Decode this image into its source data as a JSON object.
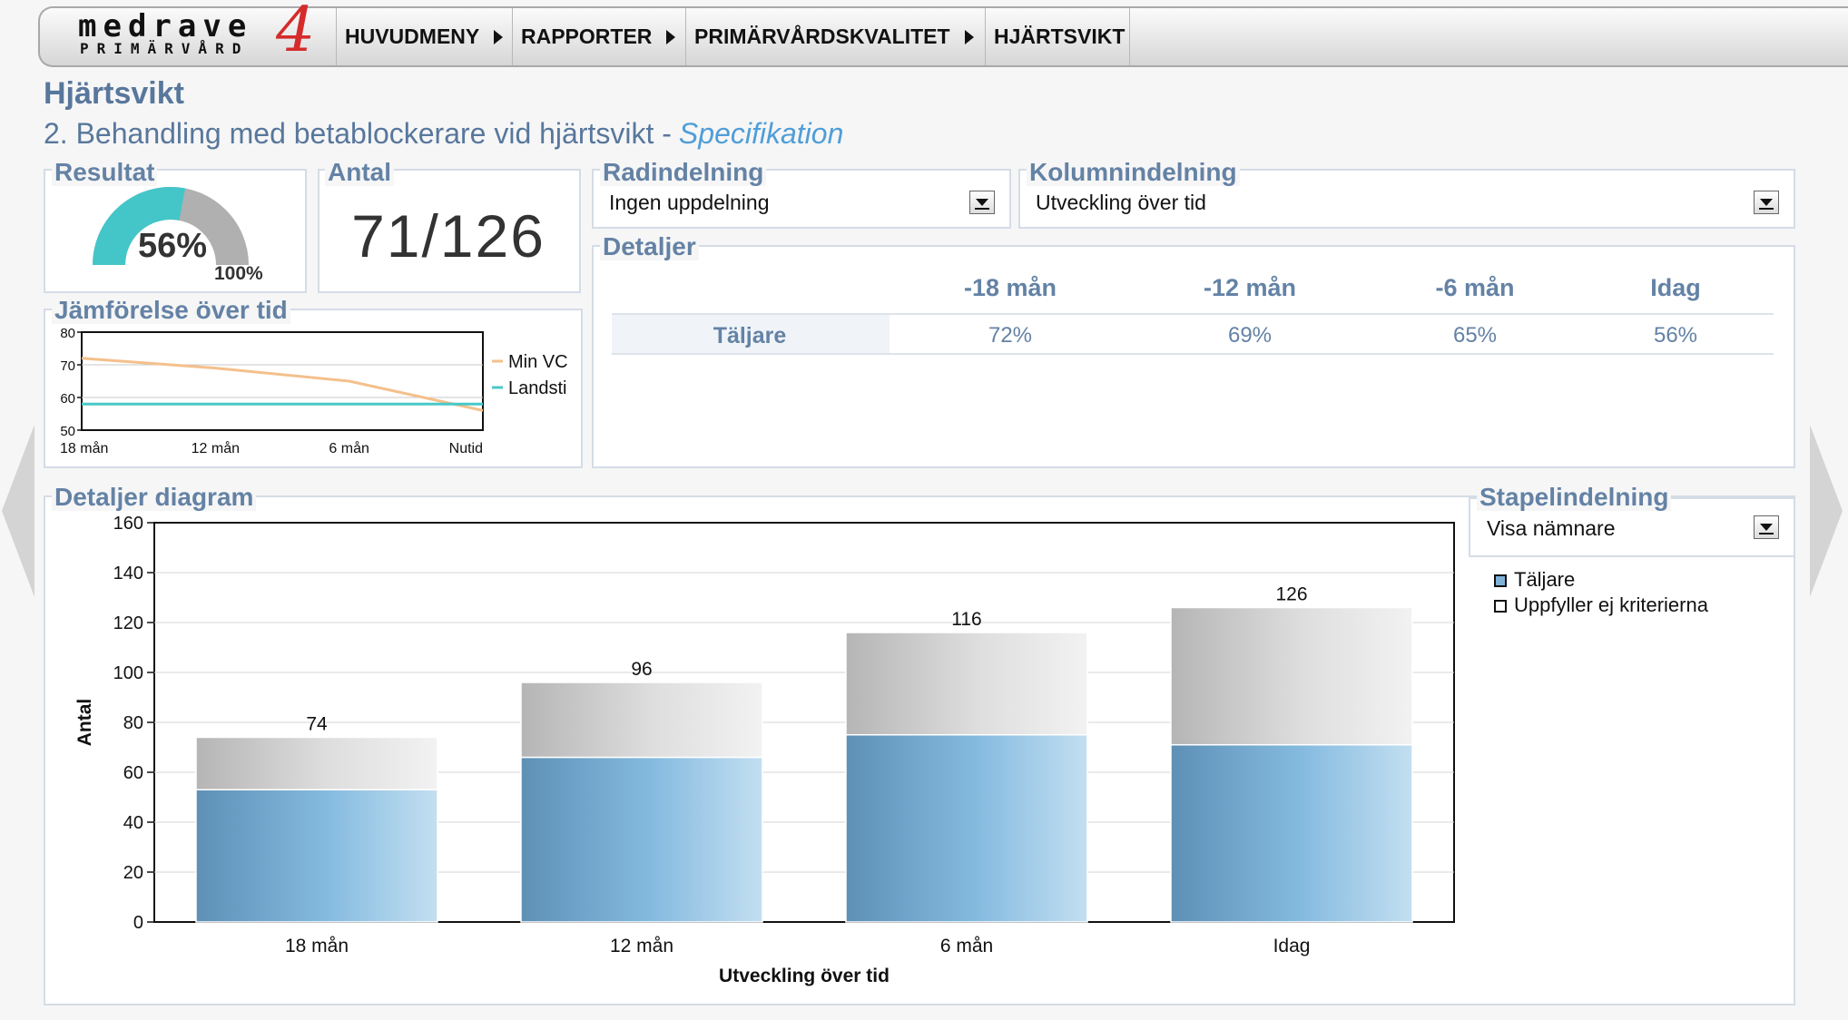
{
  "logo": {
    "word": "medrave",
    "sub": "PRIMÄRVÅRD",
    "num": "4"
  },
  "breadcrumb": [
    "HUVUDMENY",
    "RAPPORTER",
    "PRIMÄRVÅRDSKVALITET",
    "HJÄRTSVIKT"
  ],
  "page": {
    "title": "Hjärtsvikt",
    "subtitle": "2. Behandling med betablockerare vid hjärtsvikt -",
    "spec_link": "Specifikation"
  },
  "resultat": {
    "label": "Resultat",
    "value_text": "56%",
    "value": 56,
    "max_text": "100%"
  },
  "antal": {
    "label": "Antal",
    "value": "71/126"
  },
  "radindelning": {
    "label": "Radindelning",
    "selected": "Ingen uppdelning"
  },
  "kolumnindelning": {
    "label": "Kolumnindelning",
    "selected": "Utveckling över tid"
  },
  "detaljer": {
    "label": "Detaljer",
    "columns": [
      "-18 mån",
      "-12 mån",
      "-6 mån",
      "Idag"
    ],
    "rows": [
      {
        "name": "Täljare",
        "values": [
          "72%",
          "69%",
          "65%",
          "56%"
        ]
      }
    ]
  },
  "jamforelse": {
    "label": "Jämförelse över tid",
    "chart_data": {
      "type": "line",
      "x": [
        "18 mån",
        "12 mån",
        "6 mån",
        "Nutid"
      ],
      "ylim": [
        50,
        80
      ],
      "yticks": [
        50,
        60,
        70,
        80
      ],
      "series": [
        {
          "name": "Min VC",
          "values": [
            72,
            69,
            65,
            56
          ],
          "color": "#f4c08c"
        },
        {
          "name": "Landsting",
          "values": [
            58,
            58,
            58,
            58
          ],
          "color": "#48c8c8"
        }
      ],
      "legend_shown": [
        "Min VC",
        "Landsti"
      ],
      "legend": "right"
    }
  },
  "stapelindelning": {
    "label": "Stapelindelning",
    "selected": "Visa nämnare"
  },
  "diagram": {
    "label": "Detaljer diagram",
    "chart_data": {
      "type": "bar",
      "categories": [
        "18 mån",
        "12 mån",
        "6 mån",
        "Idag"
      ],
      "series": [
        {
          "name": "Täljare",
          "values": [
            53,
            66,
            75,
            71
          ],
          "color": "#7fb2d8"
        },
        {
          "name": "Uppfyller ej kriterierna",
          "values": [
            21,
            30,
            41,
            55
          ],
          "color": "#e0e0e0"
        }
      ],
      "totals": [
        74,
        96,
        116,
        126
      ],
      "ylim": [
        0,
        160
      ],
      "yticks": [
        0,
        20,
        40,
        60,
        80,
        100,
        120,
        140,
        160
      ],
      "xlabel": "Utveckling över tid",
      "ylabel": "Antal",
      "stacked": true,
      "legend": "right"
    }
  }
}
